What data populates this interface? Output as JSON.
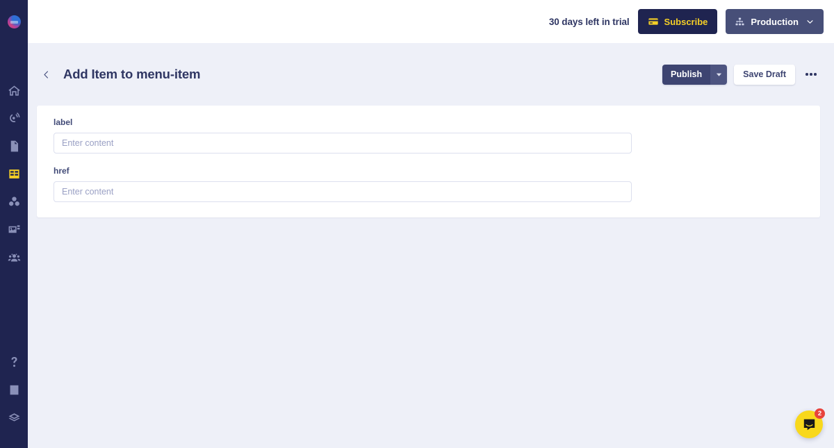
{
  "sidebar": {
    "logo_name": "logo-icon",
    "top_items": [
      {
        "name": "home-icon",
        "label": "Home",
        "active": false
      },
      {
        "name": "globe-rss-icon",
        "label": "Deliver",
        "active": false
      },
      {
        "name": "document-icon",
        "label": "Content",
        "active": false
      },
      {
        "name": "table-grid-icon",
        "label": "Collections",
        "active": true
      },
      {
        "name": "components-icon",
        "label": "Components",
        "active": false
      },
      {
        "name": "media-image-icon",
        "label": "Media",
        "active": false
      },
      {
        "name": "users-group-icon",
        "label": "Team",
        "active": false
      }
    ],
    "bottom_items": [
      {
        "name": "question-mark-icon",
        "label": "Help",
        "active": false
      },
      {
        "name": "book-icon",
        "label": "Docs",
        "active": false
      },
      {
        "name": "layers-stack-icon",
        "label": "Projects",
        "active": false
      }
    ]
  },
  "topbar": {
    "trial_text": "30 days left in trial",
    "subscribe_label": "Subscribe",
    "subscribe_icon": "credit-card-icon",
    "environment_label": "Production",
    "environment_icon": "sitemap-icon",
    "environment_caret": "chevron-down-icon"
  },
  "page_header": {
    "back_icon": "chevron-left-icon",
    "title": "Add Item to menu-item",
    "publish_label": "Publish",
    "publish_caret_icon": "caret-down-icon",
    "save_draft_label": "Save Draft",
    "more_icon": "ellipsis-icon"
  },
  "form": {
    "fields": [
      {
        "label": "label",
        "value": "",
        "placeholder": "Enter content",
        "input_name": "label-input"
      },
      {
        "label": "href",
        "value": "",
        "placeholder": "Enter content",
        "input_name": "href-input"
      }
    ]
  },
  "intercom": {
    "icon": "chat-bubble-icon",
    "badge_count": "2"
  },
  "colors": {
    "sidebar_bg": "#1f2450",
    "page_bg": "#eef0f8",
    "accent_yellow": "#f5cf26",
    "brand_navy": "#1f2450",
    "publish_navy": "#3d4471",
    "production_slate": "#474f78",
    "badge_red": "#e8433d",
    "intercom_yellow": "#f8d81c"
  }
}
